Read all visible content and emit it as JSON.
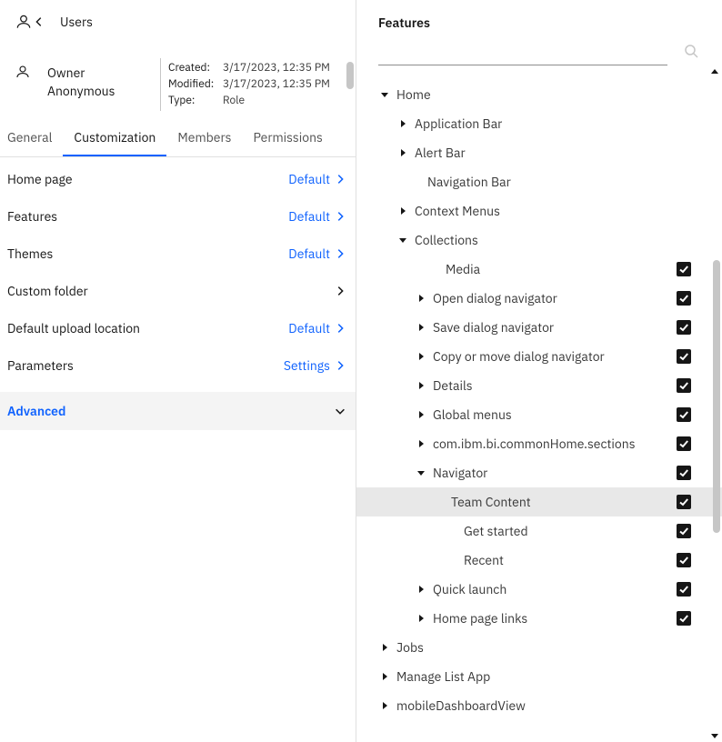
{
  "left": {
    "breadcrumb": "Users",
    "owner": {
      "role_label": "Owner",
      "name": "Anonymous"
    },
    "meta": {
      "created_label": "Created:",
      "created_value": "3/17/2023, 12:35 PM",
      "modified_label": "Modified:",
      "modified_value": "3/17/2023, 12:35 PM",
      "type_label": "Type:",
      "type_value": "Role"
    },
    "tabs": {
      "general": "General",
      "customization": "Customization",
      "members": "Members",
      "permissions": "Permissions"
    },
    "rows": {
      "home_page": {
        "label": "Home page",
        "value": "Default"
      },
      "features": {
        "label": "Features",
        "value": "Default"
      },
      "themes": {
        "label": "Themes",
        "value": "Default"
      },
      "custom_folder": {
        "label": "Custom folder",
        "value": ""
      },
      "default_upload": {
        "label": "Default upload location",
        "value": "Default"
      },
      "parameters": {
        "label": "Parameters",
        "value": "Settings"
      },
      "advanced": {
        "label": "Advanced"
      }
    }
  },
  "right": {
    "title": "Features",
    "tree": {
      "home": "Home",
      "application_bar": "Application Bar",
      "alert_bar": "Alert Bar",
      "navigation_bar": "Navigation Bar",
      "context_menus": "Context Menus",
      "collections": "Collections",
      "media": "Media",
      "open_dialog": "Open dialog navigator",
      "save_dialog": "Save dialog navigator",
      "copy_move": "Copy or move dialog navigator",
      "details": "Details",
      "global_menus": "Global menus",
      "common_home_sections": "com.ibm.bi.commonHome.sections",
      "navigator": "Navigator",
      "team_content": "Team Content",
      "get_started": "Get started",
      "recent": "Recent",
      "quick_launch": "Quick launch",
      "home_page_links": "Home page links",
      "jobs": "Jobs",
      "manage_list_app": "Manage List App",
      "mobile_dashboard_view": "mobileDashboardView"
    }
  }
}
